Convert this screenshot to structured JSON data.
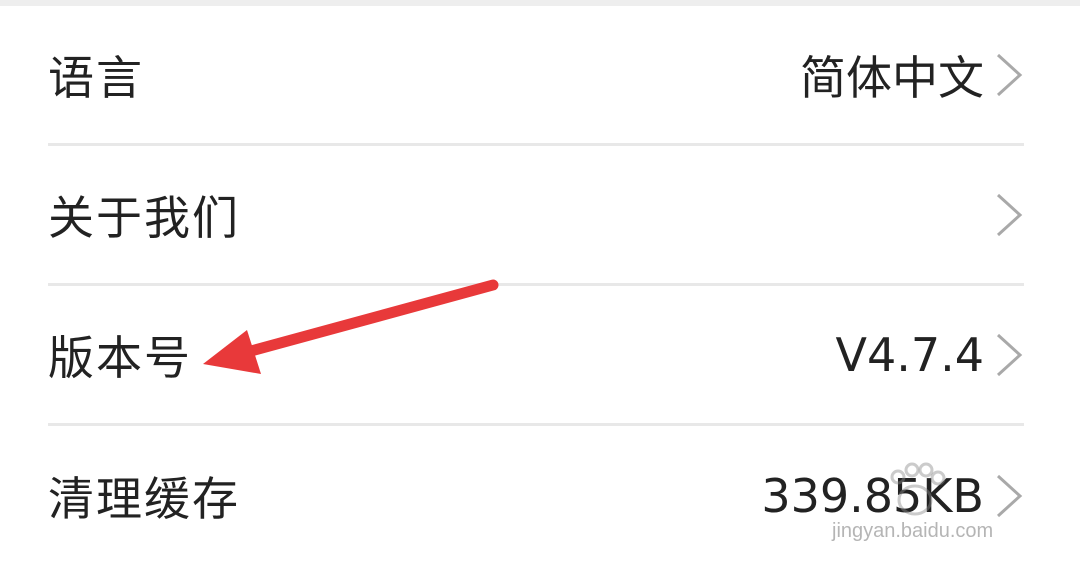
{
  "settings": {
    "items": [
      {
        "label": "语言",
        "value": "简体中文"
      },
      {
        "label": "关于我们",
        "value": ""
      },
      {
        "label": "版本号",
        "value": "V4.7.4"
      },
      {
        "label": "清理缓存",
        "value": "339.85KB"
      }
    ]
  },
  "watermark": {
    "url": "jingyan.baidu.com"
  },
  "icons": {
    "chevron": "chevron-right-icon",
    "annotation_arrow": "red-arrow-icon"
  },
  "colors": {
    "annotation": "#e8393a",
    "chevron": "#a9a9a9",
    "divider": "#e8e8e8",
    "text": "#222222"
  }
}
